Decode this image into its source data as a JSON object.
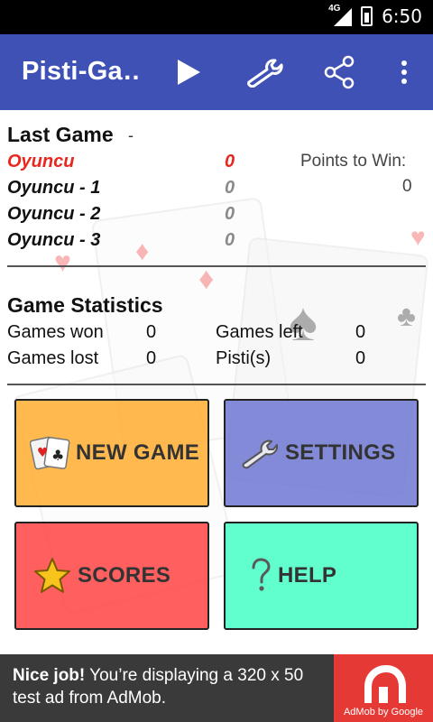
{
  "status_bar": {
    "network": "4G",
    "time": "6:50"
  },
  "action_bar": {
    "title": "Pisti-Ga…",
    "background": "#3f51b5"
  },
  "last_game": {
    "heading": "Last Game",
    "separator": "-",
    "players": [
      {
        "name": "Oyuncu",
        "score": "0"
      },
      {
        "name": "Oyuncu - 1",
        "score": "0"
      },
      {
        "name": "Oyuncu - 2",
        "score": "0"
      },
      {
        "name": "Oyuncu - 3",
        "score": "0"
      }
    ],
    "points_to_win_label": "Points to Win:",
    "points_to_win_value": "0"
  },
  "stats": {
    "heading": "Game Statistics",
    "games_won_label": "Games won",
    "games_won": "0",
    "games_lost_label": "Games lost",
    "games_lost": "0",
    "games_left_label": "Games left",
    "games_left": "0",
    "pistis_label": "Pisti(s)",
    "pistis": "0"
  },
  "buttons": {
    "new_game": "NEW GAME",
    "settings": "SETTINGS",
    "scores": "SCORES",
    "help": "HELP"
  },
  "ad": {
    "headline": "Nice job!",
    "body": "You’re displaying a 320 x 50 test ad from AdMob.",
    "logo_caption": "AdMob by Google"
  },
  "icons": {
    "play": "play-icon",
    "settings": "wrench-icon",
    "share": "share-icon",
    "overflow": "more-vert-icon",
    "new_game": "playing-cards-icon",
    "scores": "star-icon",
    "help": "question-mark-icon"
  },
  "colors": {
    "accent_red": "#e8281f",
    "new_game_bg": "#ffaa28",
    "settings_bg": "#6e78d2",
    "scores_bg": "#ff3c3c",
    "help_bg": "#50ffc8",
    "ad_logo": "#e53935"
  }
}
